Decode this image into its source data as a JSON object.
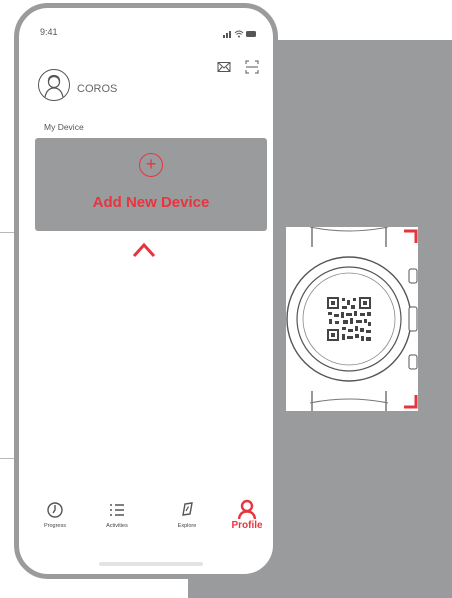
{
  "colors": {
    "accent": "#e8343f",
    "panel_gray": "#9a9b9d",
    "phone_frame": "#9a9b9d"
  },
  "status_bar": {
    "time": "9:41"
  },
  "header": {
    "icons": [
      "mail-icon",
      "scan-icon"
    ]
  },
  "profile": {
    "name": "COROS",
    "avatar_icon": "user-avatar-icon"
  },
  "devices": {
    "section_label": "My Device",
    "add_label": "Add New Device",
    "add_icon": "plus-circle-icon"
  },
  "tabbar": {
    "tabs": [
      {
        "label": "Progress",
        "icon": "progress-icon"
      },
      {
        "label": "Activities",
        "icon": "list-icon"
      },
      {
        "label": "Explore",
        "icon": "compass-icon"
      },
      {
        "label": "Profile",
        "icon": "profile-icon",
        "active": true
      }
    ]
  }
}
